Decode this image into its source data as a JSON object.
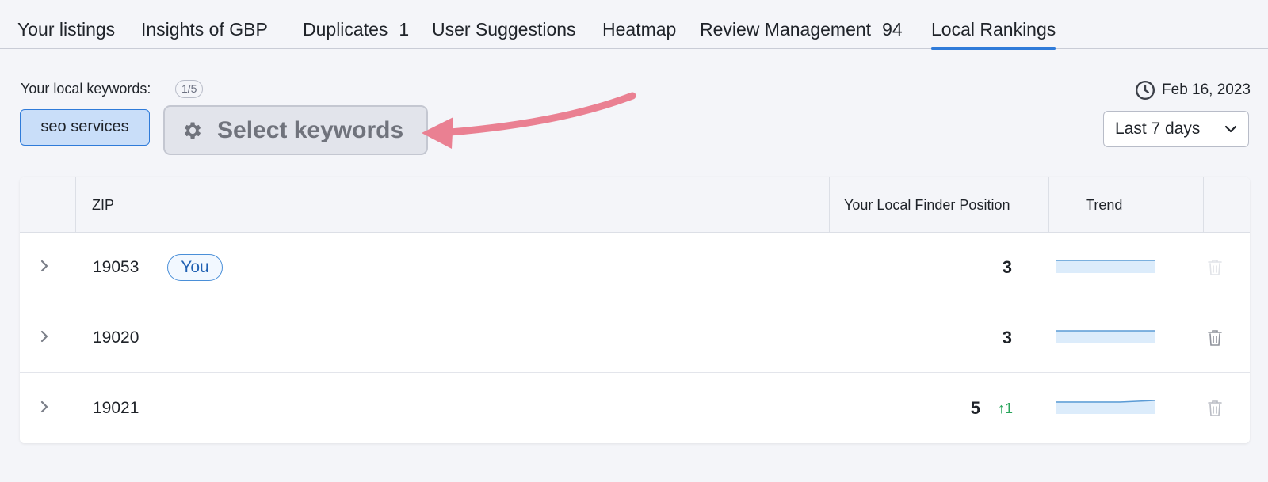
{
  "tabs": [
    {
      "label": "Your listings"
    },
    {
      "label": "Insights of GBP"
    },
    {
      "label": "Duplicates",
      "count": "1"
    },
    {
      "label": "User Suggestions"
    },
    {
      "label": "Heatmap"
    },
    {
      "label": "Review Management",
      "count": "94"
    },
    {
      "label": "Local Rankings",
      "active": true
    }
  ],
  "keywords": {
    "label": "Your local keywords:",
    "counter": "1/5",
    "selected_chip": "seo services",
    "select_button": "Select keywords"
  },
  "date": {
    "value": "Feb 16, 2023",
    "icon": "clock-icon"
  },
  "period": {
    "selected": "Last 7 days"
  },
  "table": {
    "columns": [
      "ZIP",
      "Your Local Finder Position",
      "Trend"
    ],
    "rows": [
      {
        "zip": "19053",
        "badge": "You",
        "position": "3",
        "delta": ""
      },
      {
        "zip": "19020",
        "badge": "",
        "position": "3",
        "delta": ""
      },
      {
        "zip": "19021",
        "badge": "",
        "position": "5",
        "delta": "↑1"
      }
    ]
  },
  "colors": {
    "accent": "#2f7bd9",
    "annotation_arrow": "#ea8092",
    "chip_bg": "#c9def9",
    "positive": "#2aa55c"
  }
}
